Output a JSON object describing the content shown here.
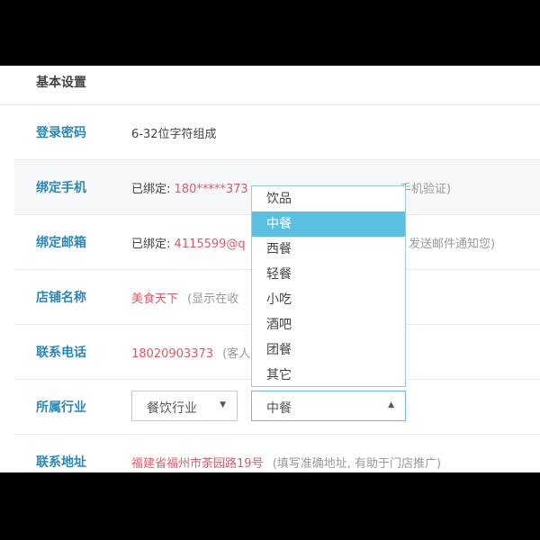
{
  "section": {
    "title": "基本设置"
  },
  "rows": {
    "password": {
      "label": "登录密码",
      "value": "6-32位字符组成"
    },
    "phone": {
      "label": "绑定手机",
      "prefix": "已绑定:",
      "number": "180*****373",
      "suffix": "手机验证)"
    },
    "email": {
      "label": "绑定邮箱",
      "prefix": "已绑定:",
      "address": "4115599@q",
      "suffix": "发送邮件通知您)"
    },
    "shop": {
      "label": "店铺名称",
      "name": "美食天下",
      "hint": "(显示在收"
    },
    "contact": {
      "label": "联系电话",
      "number": "18020903373",
      "hint": "(客人"
    },
    "industry": {
      "label": "所属行业",
      "primary": "餐饮行业",
      "secondary": "中餐"
    },
    "address": {
      "label": "联系地址",
      "value": "福建省福州市荼园路19号",
      "hint": "(填写准确地址, 有助于门店推广)"
    }
  },
  "dropdown": {
    "options": [
      "饮品",
      "中餐",
      "西餐",
      "轻餐",
      "小吃",
      "酒吧",
      "团餐",
      "其它"
    ],
    "selected": "中餐"
  },
  "colors": {
    "label": "#2a88b8",
    "highlight": "#e05a6a",
    "selected_bg": "#5bbfe0"
  },
  "icons": {
    "caret_down": "▼",
    "caret_up": "▲"
  }
}
